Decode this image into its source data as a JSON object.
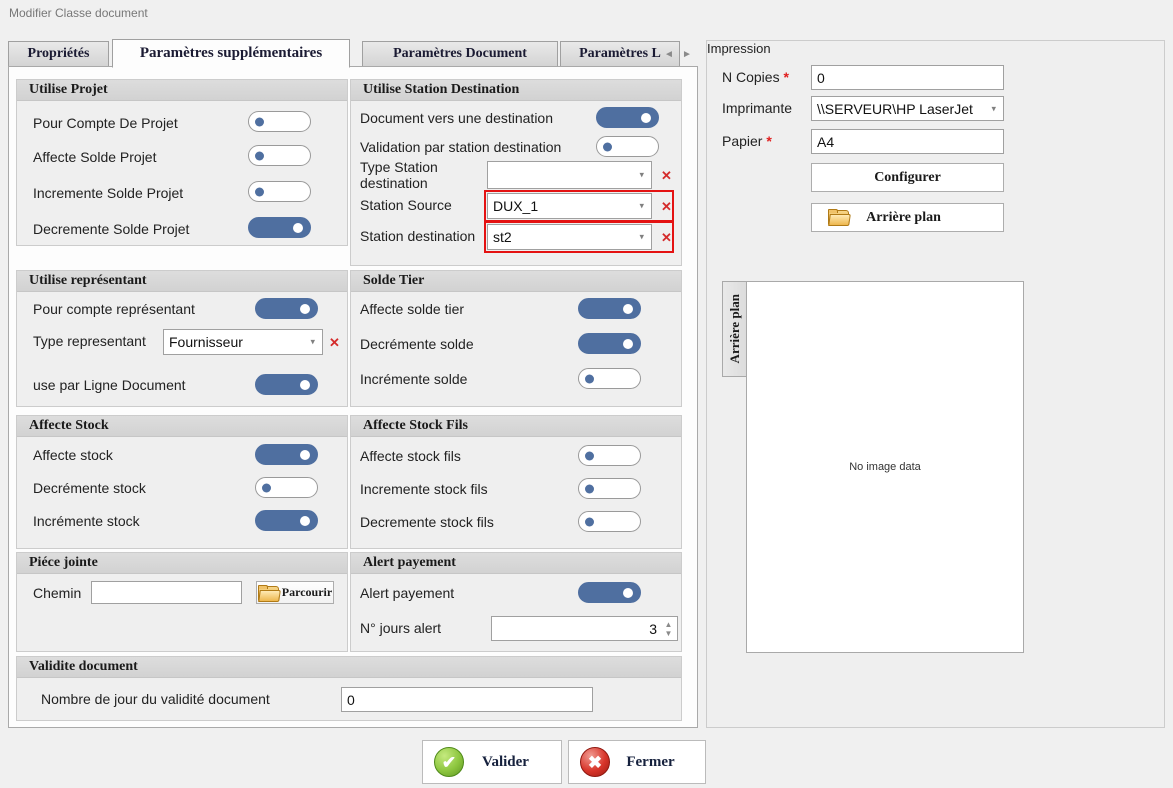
{
  "window": {
    "title": "Modifier Classe document"
  },
  "tabs": [
    {
      "label": "Propriétés",
      "active": false
    },
    {
      "label": "Paramètres supplémentaires",
      "active": true
    },
    {
      "label": "Paramètres Document",
      "active": false
    },
    {
      "label": "Paramètres L",
      "active": false
    }
  ],
  "tab_scroll": {
    "left": "◄",
    "right": "►"
  },
  "groups": {
    "utilise_projet": {
      "title": "Utilise Projet",
      "rows": [
        {
          "label": "Pour Compte De Projet",
          "state": "off"
        },
        {
          "label": "Affecte Solde Projet",
          "state": "off"
        },
        {
          "label": "Incremente Solde Projet",
          "state": "off"
        },
        {
          "label": "Decremente Solde Projet",
          "state": "on"
        }
      ]
    },
    "utilise_station_destination": {
      "title": "Utilise Station Destination",
      "rows": [
        {
          "label": "Document vers une destination",
          "state": "on"
        },
        {
          "label": "Validation par station destination",
          "state": "off"
        }
      ],
      "fields": [
        {
          "label": "Type Station destination",
          "value": "",
          "error": false
        },
        {
          "label": "Station Source",
          "value": "DUX_1",
          "error": true
        },
        {
          "label": "Station destination",
          "value": "st2",
          "error": true
        }
      ],
      "clear_glyph": "✕",
      "caret_glyph": "▾"
    },
    "utilise_representant": {
      "title": "Utilise représentant",
      "rows": [
        {
          "label": "Pour compte représentant",
          "state": "on"
        },
        {
          "label": "use par Ligne Document",
          "state": "on"
        }
      ],
      "type_label": "Type representant",
      "type_value": "Fournisseur"
    },
    "solde_tier": {
      "title": "Solde Tier",
      "rows": [
        {
          "label": "Affecte solde tier",
          "state": "on"
        },
        {
          "label": "Decrémente solde",
          "state": "on"
        },
        {
          "label": "Incrémente solde",
          "state": "off"
        }
      ]
    },
    "affecte_stock": {
      "title": "Affecte Stock",
      "rows": [
        {
          "label": "Affecte stock",
          "state": "on"
        },
        {
          "label": "Decrémente stock",
          "state": "off"
        },
        {
          "label": "Incrémente stock",
          "state": "on"
        }
      ]
    },
    "affecte_stock_fils": {
      "title": "Affecte Stock Fils",
      "rows": [
        {
          "label": "Affecte stock fils",
          "state": "off"
        },
        {
          "label": "Incremente stock fils",
          "state": "off"
        },
        {
          "label": "Decremente stock fils",
          "state": "off"
        }
      ]
    },
    "piece_jointe": {
      "title": "Piéce jointe",
      "chemin_label": "Chemin",
      "chemin_value": "",
      "browse_label": "Parcourir"
    },
    "alert_payement": {
      "title": "Alert payement",
      "toggle_label": "Alert payement",
      "toggle_state": "on",
      "days_label": "N° jours alert",
      "days_value": "3"
    },
    "validite_document": {
      "title": "Validite document",
      "label": "Nombre de jour du validité document",
      "value": "0"
    }
  },
  "impression": {
    "title": "Impression",
    "copies_label": "N Copies",
    "copies_required": "*",
    "copies_value": "0",
    "printer_label": "Imprimante",
    "printer_value": "\\\\SERVEUR\\HP LaserJet",
    "paper_label": "Papier",
    "paper_required": "*",
    "paper_value": "A4",
    "configure_label": "Configurer",
    "background_label": "Arrière plan",
    "vertical_tab_label": "Arrière plan",
    "preview_text": "No image data"
  },
  "footer": {
    "validate_label": "Valider",
    "close_label": "Fermer",
    "validate_glyph": "✔",
    "close_glyph": "✖"
  },
  "colors": {
    "toggle_on": "#4f6fa0",
    "error_border": "#e41212",
    "required_star": "#e01d1d",
    "page_bg": "#f0f0f0"
  }
}
